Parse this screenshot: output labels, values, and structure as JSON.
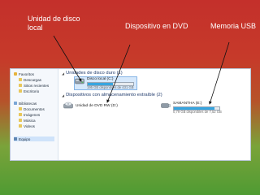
{
  "annotations": {
    "local_disk": "Unidad de disco local",
    "dvd": "Dispositivo en DVD",
    "usb": "Memoria USB"
  },
  "sidebar": {
    "items": [
      {
        "label": "Favoritos",
        "icon": "star-icon"
      },
      {
        "label": "Descargas",
        "icon": "folder-icon"
      },
      {
        "label": "Sitios recientes",
        "icon": "folder-icon"
      },
      {
        "label": "Escritorio",
        "icon": "folder-icon"
      },
      {
        "label": "Bibliotecas",
        "icon": "library-icon"
      },
      {
        "label": "Documentos",
        "icon": "folder-icon"
      },
      {
        "label": "Imágenes",
        "icon": "folder-icon"
      },
      {
        "label": "Música",
        "icon": "folder-icon"
      },
      {
        "label": "Videos",
        "icon": "folder-icon"
      },
      {
        "label": "Equipo",
        "icon": "computer-icon"
      }
    ]
  },
  "main": {
    "groups": [
      {
        "title": "Unidades de disco duro (1)"
      },
      {
        "title": "Dispositivos con almacenamiento extraíble (2)"
      }
    ],
    "drives": {
      "local": {
        "name": "Disco local (C:)",
        "info": "195 GB disponibles de 431 GB",
        "used_fraction": 0.55
      },
      "dvd": {
        "name": "Unidad de DVD RW (D:)"
      },
      "usb": {
        "name": "SAMANTHA (E:)",
        "info": "0,79 GB disponibles de 7,52 GB",
        "used_fraction": 0.9
      }
    }
  },
  "colors": {
    "background_top": "#c4302b",
    "background_bottom": "#4f9b33",
    "bar_fill": "#37a5e0"
  }
}
